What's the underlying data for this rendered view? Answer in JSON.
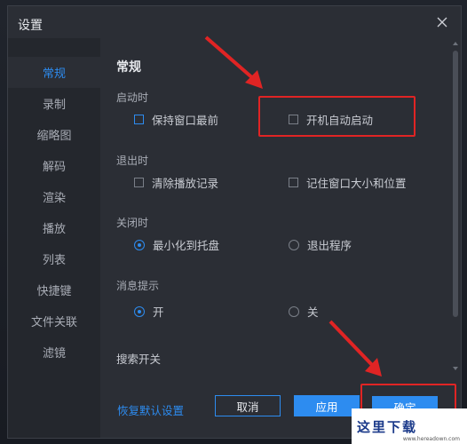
{
  "dialog": {
    "title": "设置"
  },
  "sidebar": {
    "items": [
      {
        "label": "常规",
        "active": true
      },
      {
        "label": "录制"
      },
      {
        "label": "缩略图"
      },
      {
        "label": "解码"
      },
      {
        "label": "渲染"
      },
      {
        "label": "播放"
      },
      {
        "label": "列表"
      },
      {
        "label": "快捷键"
      },
      {
        "label": "文件关联"
      },
      {
        "label": "滤镜"
      }
    ]
  },
  "content": {
    "section_title": "常规",
    "startup": {
      "label": "启动时",
      "keep_on_top": {
        "label": "保持窗口最前",
        "checked": false
      },
      "auto_start": {
        "label": "开机自动启动",
        "checked": false
      }
    },
    "exit": {
      "label": "退出时",
      "clear_history": {
        "label": "清除播放记录",
        "checked": false
      },
      "remember_window": {
        "label": "记住窗口大小和位置",
        "checked": false
      }
    },
    "close": {
      "label": "关闭时",
      "minimize_tray": {
        "label": "最小化到托盘",
        "selected": true
      },
      "exit_program": {
        "label": "退出程序",
        "selected": false
      }
    },
    "notify": {
      "label": "消息提示",
      "on": {
        "label": "开",
        "selected": true
      },
      "off": {
        "label": "关",
        "selected": false
      }
    },
    "search": {
      "label": "搜索开关"
    }
  },
  "footer": {
    "reset_label": "恢复默认设置",
    "cancel_label": "取消",
    "apply_label": "应用",
    "ok_label": "确定"
  },
  "watermark": {
    "text": "这里下载",
    "sub": "www.hereadown.com"
  },
  "colors": {
    "accent": "#2d8cf0",
    "highlight": "#e02424",
    "bg": "#2b2e35",
    "sidebar": "#24272d"
  },
  "icons": {
    "close": "close-icon"
  }
}
